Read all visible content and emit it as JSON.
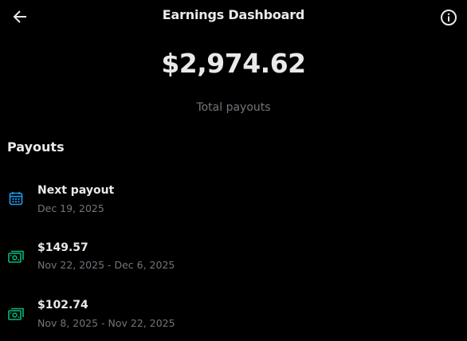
{
  "header": {
    "title": "Earnings Dashboard",
    "back_icon": "arrow-left-icon",
    "info_icon": "info-circle-icon"
  },
  "summary": {
    "total_amount": "$2,974.62",
    "total_label": "Total payouts"
  },
  "payouts": {
    "section_title": "Payouts",
    "items": [
      {
        "icon": "calendar-icon",
        "title": "Next payout",
        "subtitle": "Dec 19, 2025"
      },
      {
        "icon": "money-icon",
        "title": "$149.57",
        "subtitle": "Nov 22, 2025 - Dec 6, 2025"
      },
      {
        "icon": "money-icon",
        "title": "$102.74",
        "subtitle": "Nov 8, 2025 - Nov 22, 2025"
      }
    ]
  },
  "colors": {
    "background": "#000000",
    "text_primary": "#e7e9ea",
    "text_secondary": "#71767b",
    "calendar_blue": "#1d9bf0",
    "money_green": "#00ba7c"
  }
}
